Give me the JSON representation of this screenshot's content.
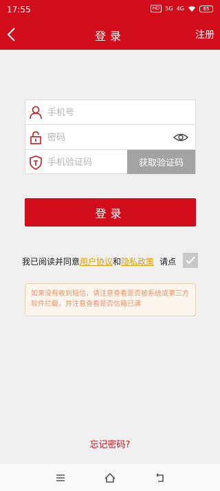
{
  "status_bar": {
    "time": "17:55",
    "hd_label": "HD",
    "network_label": "5G",
    "network2_label": "4G",
    "battery": "65"
  },
  "header": {
    "title": "登录",
    "register": "注册"
  },
  "form": {
    "phone_placeholder": "手机号",
    "password_placeholder": "密码",
    "code_placeholder": "手机验证码",
    "get_code_label": "获取验证码"
  },
  "login_label": "登录",
  "agreement": {
    "prefix": "我已阅读并同意",
    "user_agreement": "用户协议",
    "and": "和",
    "privacy_policy": "隐私政策",
    "suffix": "请点"
  },
  "notice": "如果没有收到短信，请注意查看是否被系统或第三方软件拦截，并注意查看是否信箱已满",
  "forgot_password": "忘记密码?",
  "colors": {
    "brand": "#d20d1b",
    "link": "#e0a100",
    "notice_text": "#e8936a"
  }
}
